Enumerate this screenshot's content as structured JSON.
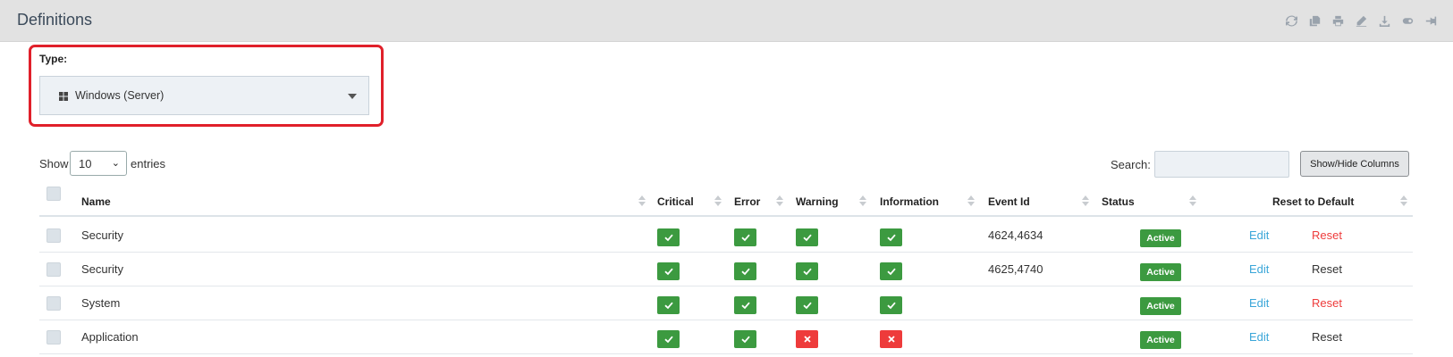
{
  "header": {
    "title": "Definitions",
    "tools": [
      "refresh-icon",
      "copy-icon",
      "print-icon",
      "edit-icon",
      "download-icon",
      "toggle-icon",
      "pin-icon"
    ]
  },
  "type_filter": {
    "label": "Type:",
    "selected": "Windows (Server)",
    "highlight_color": "#e0202a"
  },
  "length": {
    "show_label": "Show",
    "value": "10",
    "entries_label": "entries"
  },
  "search": {
    "label": "Search:",
    "value": ""
  },
  "show_hide_button": "Show/Hide Columns",
  "table": {
    "columns": {
      "name": "Name",
      "critical": "Critical",
      "error": "Error",
      "warning": "Warning",
      "information": "Information",
      "event_id": "Event Id",
      "status": "Status",
      "reset": "Reset to Default"
    },
    "rows": [
      {
        "name": "Security",
        "critical": true,
        "error": true,
        "warning": true,
        "information": true,
        "event_id": "4624,4634",
        "status": "Active",
        "edit": "Edit",
        "reset": "Reset",
        "reset_color": "red"
      },
      {
        "name": "Security",
        "critical": true,
        "error": true,
        "warning": true,
        "information": true,
        "event_id": "4625,4740",
        "status": "Active",
        "edit": "Edit",
        "reset": "Reset",
        "reset_color": "black"
      },
      {
        "name": "System",
        "critical": true,
        "error": true,
        "warning": true,
        "information": true,
        "event_id": "",
        "status": "Active",
        "edit": "Edit",
        "reset": "Reset",
        "reset_color": "red"
      },
      {
        "name": "Application",
        "critical": true,
        "error": true,
        "warning": false,
        "information": false,
        "event_id": "",
        "status": "Active",
        "edit": "Edit",
        "reset": "Reset",
        "reset_color": "black"
      }
    ]
  },
  "colors": {
    "enabled": "#3c9a40",
    "disabled": "#ee3b3b",
    "link": "#3aa6d9"
  }
}
